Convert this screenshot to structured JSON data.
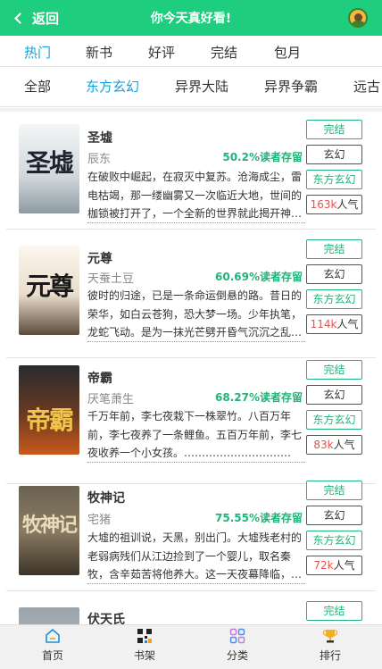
{
  "header": {
    "back_label": "返回",
    "title": "你今天真好看!"
  },
  "tabs_primary": [
    "热门",
    "新书",
    "好评",
    "完结",
    "包月"
  ],
  "tabs_secondary": [
    "全部",
    "东方玄幻",
    "异界大陆",
    "异界争霸",
    "远古"
  ],
  "books": [
    {
      "title": "圣墟",
      "author": "辰东",
      "retention": "50.2%读者存留",
      "description": "在破败中崛起，在寂灭中复苏。沧海成尘，雷电枯竭，那一缕幽雾又一次临近大地，世间的枷锁被打开了，一个全新的世界就此揭开神…",
      "status": "完结",
      "category": "玄幻",
      "genre": "东方玄幻",
      "popularity": "163k",
      "popularity_unit": "人气",
      "cover_text": "圣墟"
    },
    {
      "title": "元尊",
      "author": "天蚕土豆",
      "retention": "60.69%读者存留",
      "description": "彼时的归途，已是一条命运倒悬的路。昔日的荣华，如白云苍狗，恐大梦一场。少年执笔，龙蛇飞动。是为一抹光芒劈开昏气沉沉之乱…",
      "status": "完结",
      "category": "玄幻",
      "genre": "东方玄幻",
      "popularity": "114k",
      "popularity_unit": "人气",
      "cover_text": "元尊"
    },
    {
      "title": "帝霸",
      "author": "厌笔萧生",
      "retention": "68.27%读者存留",
      "description": "千万年前，李七夜栽下一株翠竹。八百万年前，李七夜养了一条鲤鱼。五百万年前，李七夜收养一个小女孩。…………………………",
      "status": "完结",
      "category": "玄幻",
      "genre": "东方玄幻",
      "popularity": "83k",
      "popularity_unit": "人气",
      "cover_text": "帝霸"
    },
    {
      "title": "牧神记",
      "author": "宅猪",
      "retention": "75.55%读者存留",
      "description": "大墟的祖训说，天黑，别出门。大墟残老村的老弱病残们从江边捡到了一个婴儿，取名秦牧，含辛茹苦将他养大。这一天夜幕降临，…",
      "status": "完结",
      "category": "玄幻",
      "genre": "东方玄幻",
      "popularity": "72k",
      "popularity_unit": "人气",
      "cover_text": "牧神记"
    },
    {
      "title": "伏天氏",
      "status": "完结"
    }
  ],
  "bottom_nav": [
    {
      "label": "首页",
      "icon": "home-icon"
    },
    {
      "label": "书架",
      "icon": "bookshelf-icon"
    },
    {
      "label": "分类",
      "icon": "category-icon"
    },
    {
      "label": "排行",
      "icon": "trophy-icon"
    }
  ]
}
